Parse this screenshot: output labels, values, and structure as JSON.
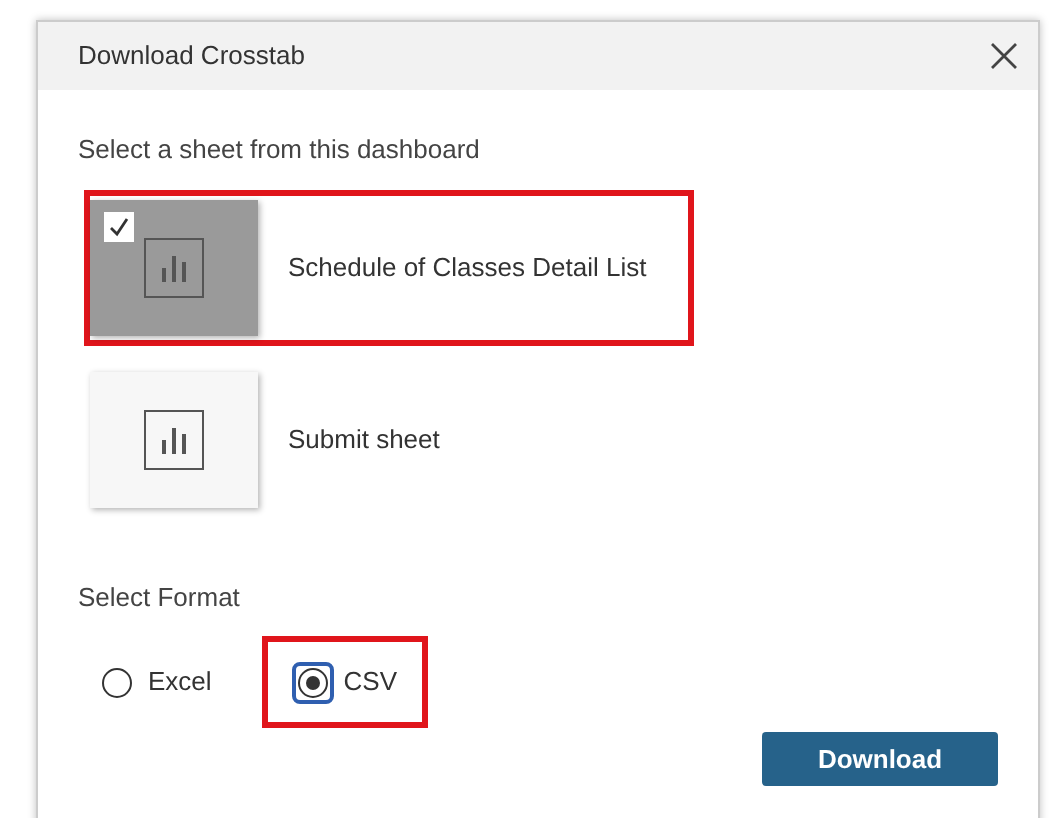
{
  "dialog": {
    "title": "Download Crosstab"
  },
  "sheet_prompt": "Select a sheet from this dashboard",
  "sheets": [
    {
      "name": "Schedule of Classes Detail List",
      "selected": true,
      "annotated": true
    },
    {
      "name": "Submit sheet",
      "selected": false,
      "annotated": false
    }
  ],
  "format_prompt": "Select Format",
  "formats": [
    {
      "label": "Excel",
      "selected": false,
      "annotated": false
    },
    {
      "label": "CSV",
      "selected": true,
      "annotated": true
    }
  ],
  "buttons": {
    "download": "Download"
  }
}
